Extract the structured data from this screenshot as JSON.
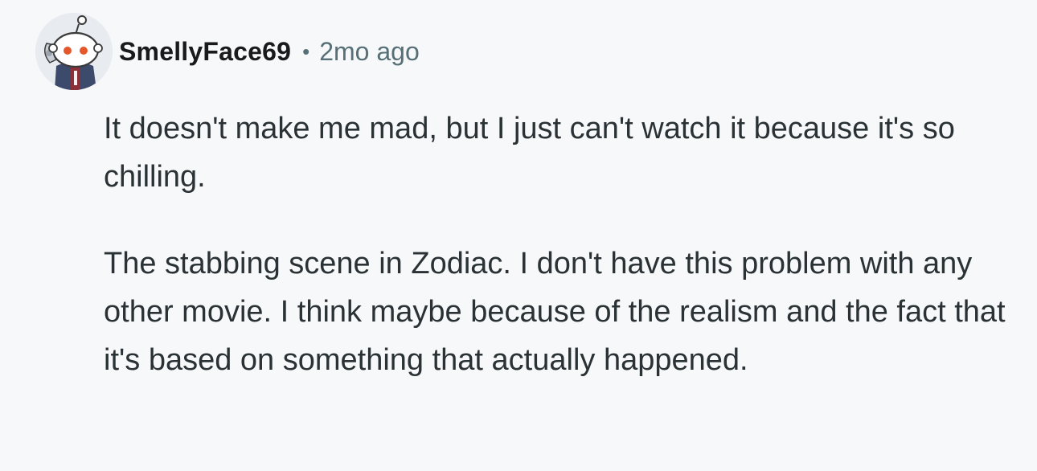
{
  "comment": {
    "author": "SmellyFace69",
    "separator": "•",
    "timestamp": "2mo ago",
    "avatar_icon": "snoo-avatar-icon",
    "paragraphs": [
      "It doesn't make me mad, but I just can't watch it because it's so chilling.",
      "The stabbing scene in Zodiac. I don't have this problem with any other movie. I think maybe because of the realism and the fact that it's based on something that actually happened."
    ]
  },
  "colors": {
    "background": "#f7f8fa",
    "username": "#1a1a1b",
    "meta": "#576f76",
    "body_text": "#2a3236"
  }
}
